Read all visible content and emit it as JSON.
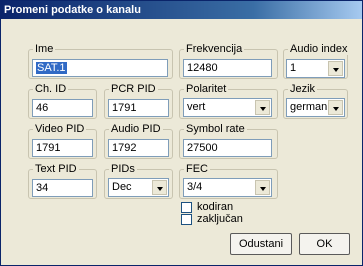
{
  "window": {
    "title": "Promeni podatke o kanalu"
  },
  "fields": {
    "ime": {
      "label": "Ime",
      "value": "SAT.1"
    },
    "frekvencija": {
      "label": "Frekvencija",
      "value": "12480"
    },
    "audio_index": {
      "label": "Audio index",
      "value": "1"
    },
    "ch_id": {
      "label": "Ch. ID",
      "value": "46"
    },
    "pcr_pid": {
      "label": "PCR PID",
      "value": "1791"
    },
    "polaritet": {
      "label": "Polaritet",
      "value": "vert"
    },
    "jezik": {
      "label": "Jezik",
      "value": "german"
    },
    "video_pid": {
      "label": "Video PID",
      "value": "1791"
    },
    "audio_pid": {
      "label": "Audio PID",
      "value": "1792"
    },
    "symbol_rate": {
      "label": "Symbol rate",
      "value": "27500"
    },
    "text_pid": {
      "label": "Text PID",
      "value": "34"
    },
    "pids": {
      "label": "PIDs",
      "value": "Dec"
    },
    "fec": {
      "label": "FEC",
      "value": "3/4"
    }
  },
  "checkboxes": {
    "kodiran": {
      "label": "kodiran",
      "checked": false
    },
    "zakljucan": {
      "label": "zaključan",
      "checked": false
    }
  },
  "buttons": {
    "cancel": "Odustani",
    "ok": "OK"
  }
}
